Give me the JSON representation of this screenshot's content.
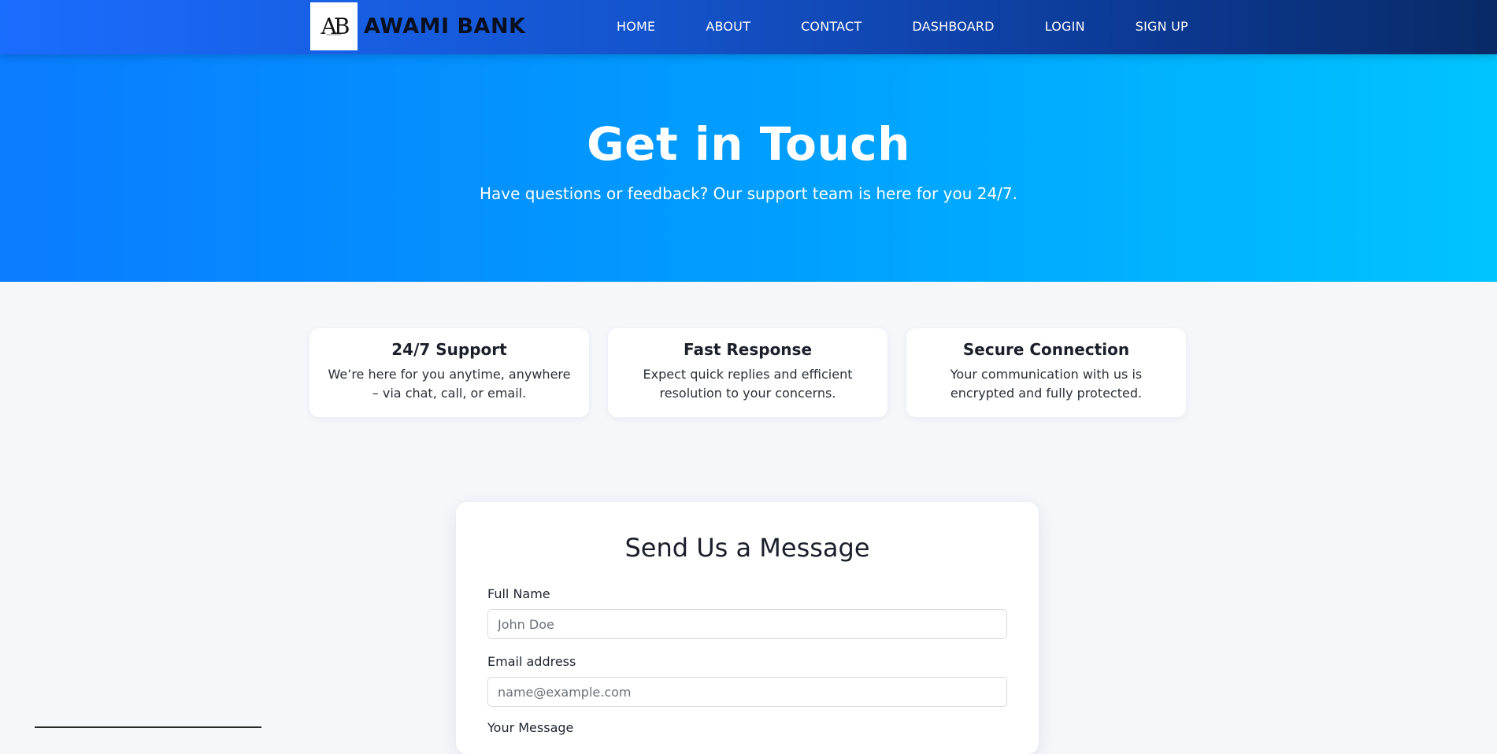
{
  "brand": {
    "logo_text": "AB",
    "logo_sub": "AWAMI BANK",
    "name": "AWAMI BANK"
  },
  "nav": {
    "items": [
      {
        "label": "HOME"
      },
      {
        "label": "ABOUT"
      },
      {
        "label": "CONTACT"
      },
      {
        "label": "DASHBOARD"
      },
      {
        "label": "LOGIN"
      },
      {
        "label": "SIGN UP"
      }
    ]
  },
  "hero": {
    "title": "Get in Touch",
    "subtitle": "Have questions or feedback? Our support team is here for you 24/7."
  },
  "features": [
    {
      "title": "24/7 Support",
      "text": "We’re here for you anytime, anywhere – via chat, call, or email."
    },
    {
      "title": "Fast Response",
      "text": "Expect quick replies and efficient resolution to your concerns."
    },
    {
      "title": "Secure Connection",
      "text": "Your communication with us is encrypted and fully protected."
    }
  ],
  "form": {
    "title": "Send Us a Message",
    "name_label": "Full Name",
    "name_placeholder": "John Doe",
    "email_label": "Email address",
    "email_placeholder": "name@example.com",
    "message_label": "Your Message"
  },
  "colors": {
    "nav_gradient_start": "#1b6dff",
    "nav_gradient_end": "#082a66",
    "hero_gradient_start": "#0a7cff",
    "hero_gradient_end": "#00c4ff",
    "page_background": "#f5f7fb"
  }
}
